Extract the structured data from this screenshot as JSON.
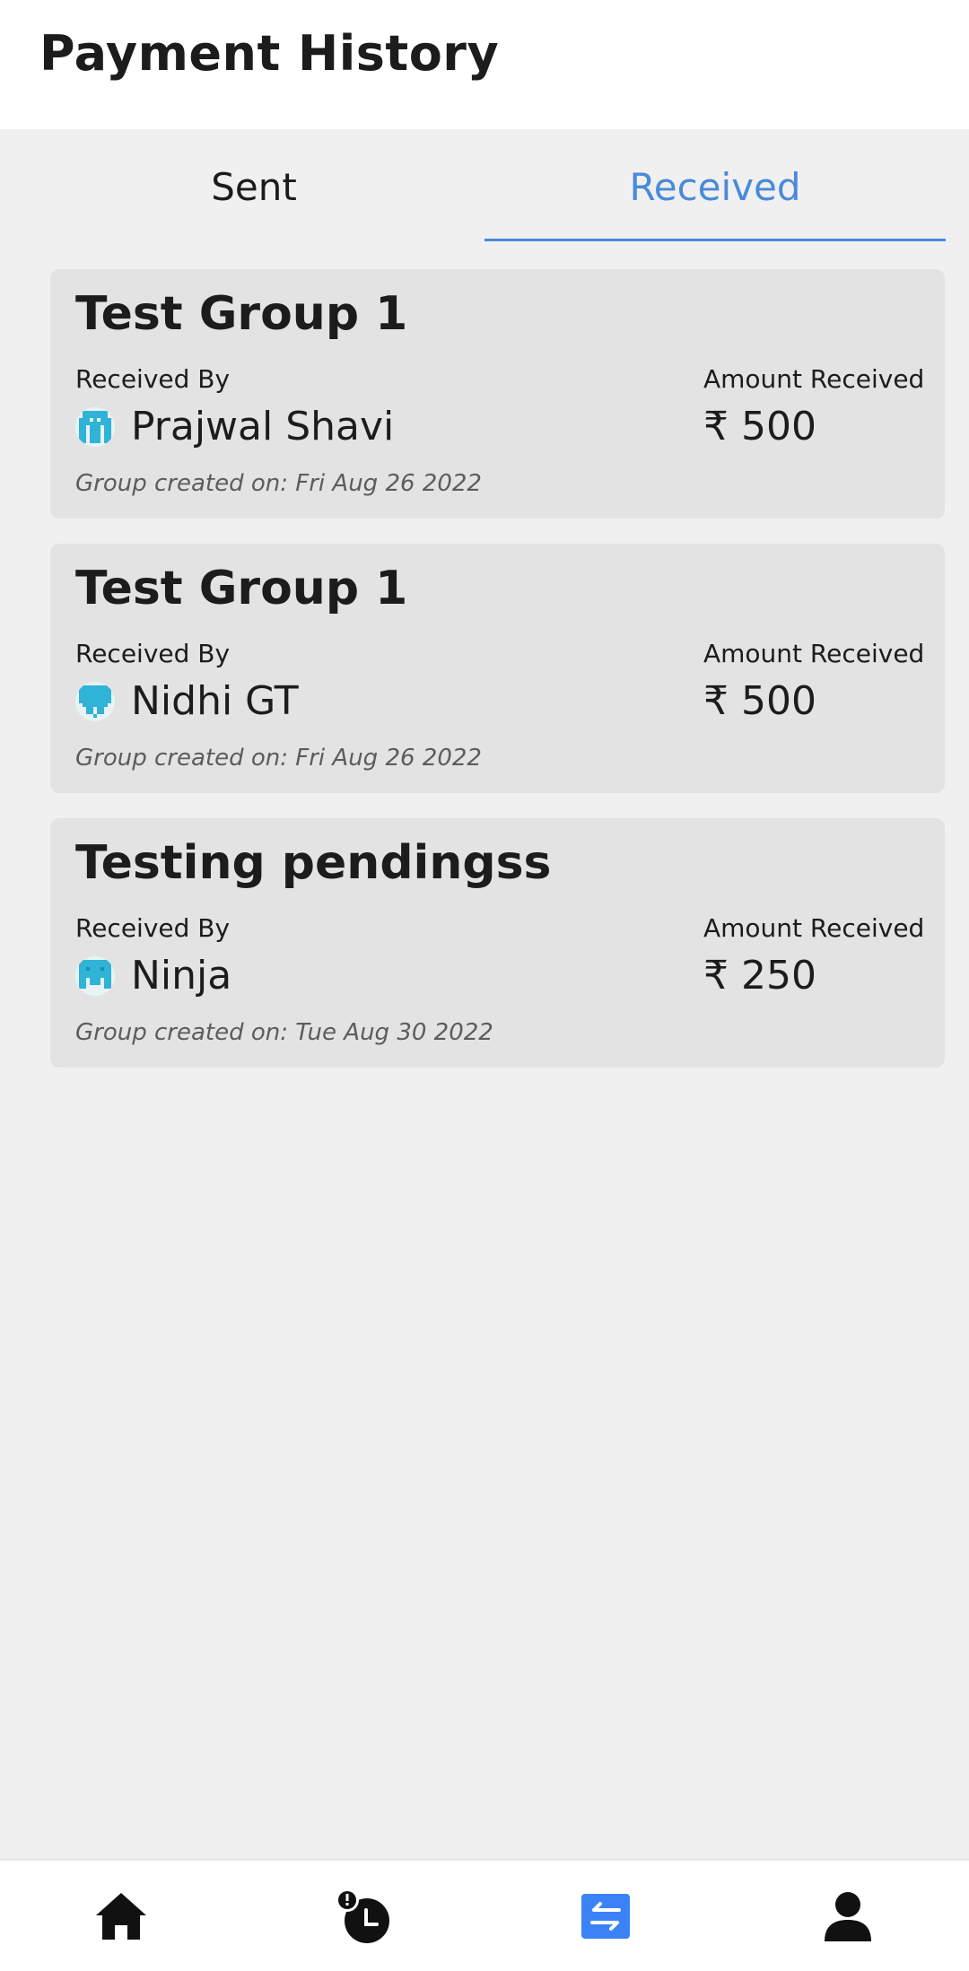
{
  "header": {
    "title": "Payment History"
  },
  "tabs": [
    {
      "label": "Sent",
      "active": false
    },
    {
      "label": "Received",
      "active": true
    }
  ],
  "colors": {
    "accent": "#4a8ad9",
    "card_bg": "#e3e3e3",
    "page_bg": "#f0f0f0",
    "avatar": "#2fb3d6"
  },
  "payments": [
    {
      "group": "Test Group 1",
      "received_by_label": "Received By",
      "amount_label": "Amount Received",
      "receiver": "Prajwal Shavi",
      "avatar_icon": "pixel-avatar-icon",
      "amount": "₹ 500",
      "created": "Group created on: Fri Aug 26 2022"
    },
    {
      "group": "Test Group 1",
      "received_by_label": "Received By",
      "amount_label": "Amount Received",
      "receiver": "Nidhi GT",
      "avatar_icon": "pixel-avatar-icon",
      "amount": "₹ 500",
      "created": "Group created on: Fri Aug 26 2022"
    },
    {
      "group": "Testing pendingss",
      "received_by_label": "Received By",
      "amount_label": "Amount Received",
      "receiver": "Ninja",
      "avatar_icon": "pixel-avatar-icon",
      "amount": "₹ 250",
      "created": "Group created on: Tue Aug 30 2022"
    }
  ],
  "bottom_nav": [
    {
      "icon": "home-icon",
      "active": false
    },
    {
      "icon": "pending-clock-icon",
      "active": false
    },
    {
      "icon": "transfer-icon",
      "active": true
    },
    {
      "icon": "profile-icon",
      "active": false
    }
  ]
}
